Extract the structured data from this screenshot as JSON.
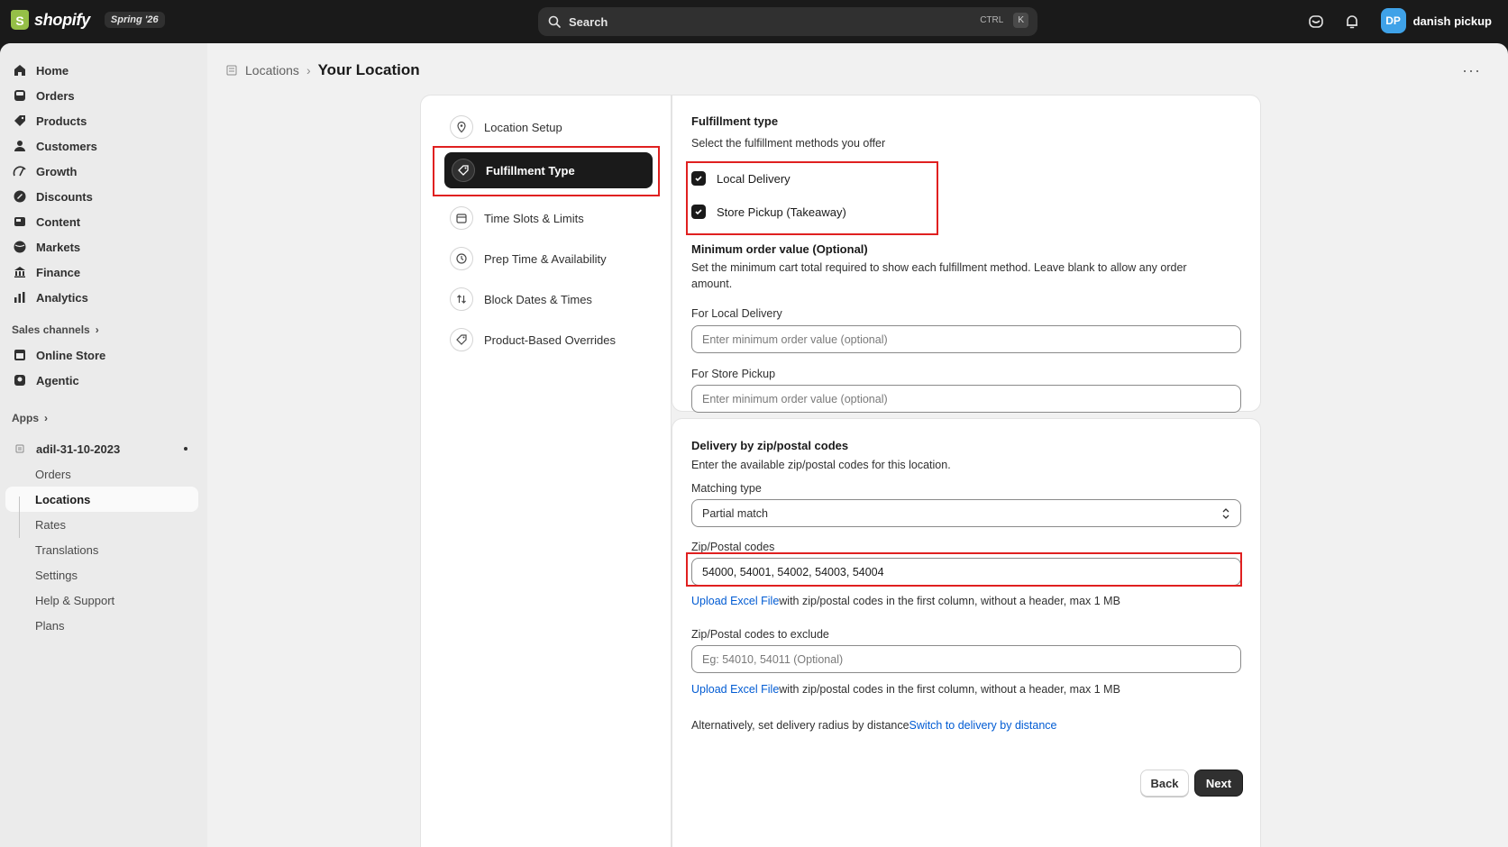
{
  "topbar": {
    "brand": "shopify",
    "edition": "Spring '26",
    "search_label": "Search",
    "search_shortcut_ctrl": "CTRL",
    "search_shortcut_key": "K",
    "user_initials": "DP",
    "user_name": "danish pickup",
    "avatar_color": "#3fa2e8"
  },
  "sidebar": {
    "items": [
      {
        "label": "Home",
        "icon": "home-icon"
      },
      {
        "label": "Orders",
        "icon": "inbox-icon"
      },
      {
        "label": "Products",
        "icon": "tag-icon"
      },
      {
        "label": "Customers",
        "icon": "person-icon"
      },
      {
        "label": "Growth",
        "icon": "growth-icon"
      },
      {
        "label": "Discounts",
        "icon": "discount-icon"
      },
      {
        "label": "Content",
        "icon": "content-icon"
      },
      {
        "label": "Markets",
        "icon": "globe-icon"
      },
      {
        "label": "Finance",
        "icon": "bank-icon"
      },
      {
        "label": "Analytics",
        "icon": "bar-chart-icon"
      }
    ],
    "sales_channels_label": "Sales channels",
    "channels": [
      {
        "label": "Online Store",
        "icon": "store-icon"
      },
      {
        "label": "Agentic",
        "icon": "agent-icon"
      }
    ],
    "apps_label": "Apps",
    "app_name": "adil-31-10-2023",
    "app_items": [
      "Orders",
      "Locations",
      "Rates",
      "Translations",
      "Settings",
      "Help & Support",
      "Plans"
    ],
    "active_app_item": "Locations"
  },
  "breadcrumb": {
    "parent": "Locations",
    "separator": "›",
    "current": "Your Location"
  },
  "steps": [
    {
      "label": "Location Setup",
      "icon": "location-pin-icon"
    },
    {
      "label": "Fulfillment Type",
      "icon": "tag-icon",
      "active": true
    },
    {
      "label": "Time Slots & Limits",
      "icon": "calendar-icon"
    },
    {
      "label": "Prep Time & Availability",
      "icon": "clock-icon"
    },
    {
      "label": "Block Dates & Times",
      "icon": "arrows-updown-icon"
    },
    {
      "label": "Product-Based Overrides",
      "icon": "tag-icon"
    }
  ],
  "fulfillment": {
    "title": "Fulfillment type",
    "subtitle": "Select the fulfillment methods you offer",
    "options": [
      {
        "label": "Local Delivery",
        "checked": true
      },
      {
        "label": "Store Pickup (Takeaway)",
        "checked": true
      }
    ],
    "min_order_title": "Minimum order value (Optional)",
    "min_order_desc": "Set the minimum cart total required to show each fulfillment method. Leave blank to allow any order amount.",
    "local_delivery_label": "For Local Delivery",
    "local_delivery_placeholder": "Enter minimum order value (optional)",
    "store_pickup_label": "For Store Pickup",
    "store_pickup_placeholder": "Enter minimum order value (optional)"
  },
  "zip": {
    "title": "Delivery by zip/postal codes",
    "subtitle": "Enter the available zip/postal codes for this location.",
    "matching_label": "Matching type",
    "matching_value": "Partial match",
    "codes_label": "Zip/Postal codes",
    "codes_value": "54000, 54001, 54002, 54003, 54004",
    "upload_link": "Upload Excel File",
    "upload_note": "with zip/postal codes in the first column, without a header, max 1 MB",
    "exclude_label": "Zip/Postal codes to exclude",
    "exclude_placeholder": "Eg: 54010, 54011 (Optional)",
    "upload_link2": "Upload Excel File",
    "upload_note2": "with zip/postal codes in the first column, without a header, max 1 MB",
    "alt_text": "Alternatively, set delivery radius by distance",
    "alt_link": "Switch to delivery by distance"
  },
  "actions": {
    "back": "Back",
    "next": "Next"
  },
  "colors": {
    "highlight": "#e02020",
    "link": "#005bd3",
    "dark": "#1a1a1a"
  }
}
